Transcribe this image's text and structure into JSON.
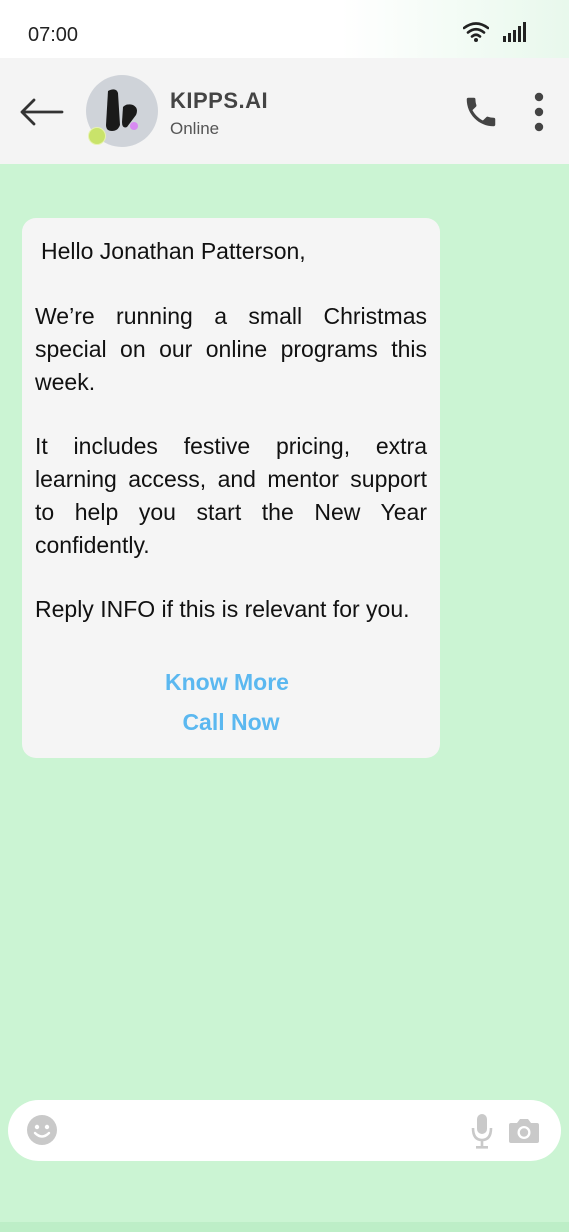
{
  "status_bar": {
    "time": "07:00"
  },
  "header": {
    "back_icon": "arrow-left-icon",
    "contact_name": "KIPPS.AI",
    "contact_status": "Online",
    "call_icon": "phone-icon",
    "menu_icon": "more-vertical-icon"
  },
  "message": {
    "greeting": "Hello Jonathan Patterson,",
    "paragraph_1": "We’re running a small Christmas special on our online programs this week.",
    "paragraph_2": "It includes festive pricing, extra learning access, and mentor support to help you start the New Year confidently.",
    "paragraph_3": "Reply INFO if this is relevant for you.",
    "actions": [
      {
        "label": "Know More"
      },
      {
        "label": "Call Now"
      }
    ]
  },
  "composer": {
    "placeholder": "",
    "emoji_icon": "emoji-icon",
    "mic_icon": "mic-icon",
    "camera_icon": "camera-icon"
  },
  "colors": {
    "chat_background": "#cbf4d3",
    "header_background": "#f4f4f4",
    "bubble_background": "#f5f5f5",
    "action_link": "#5bb8f0",
    "presence": "#c9e36a"
  }
}
